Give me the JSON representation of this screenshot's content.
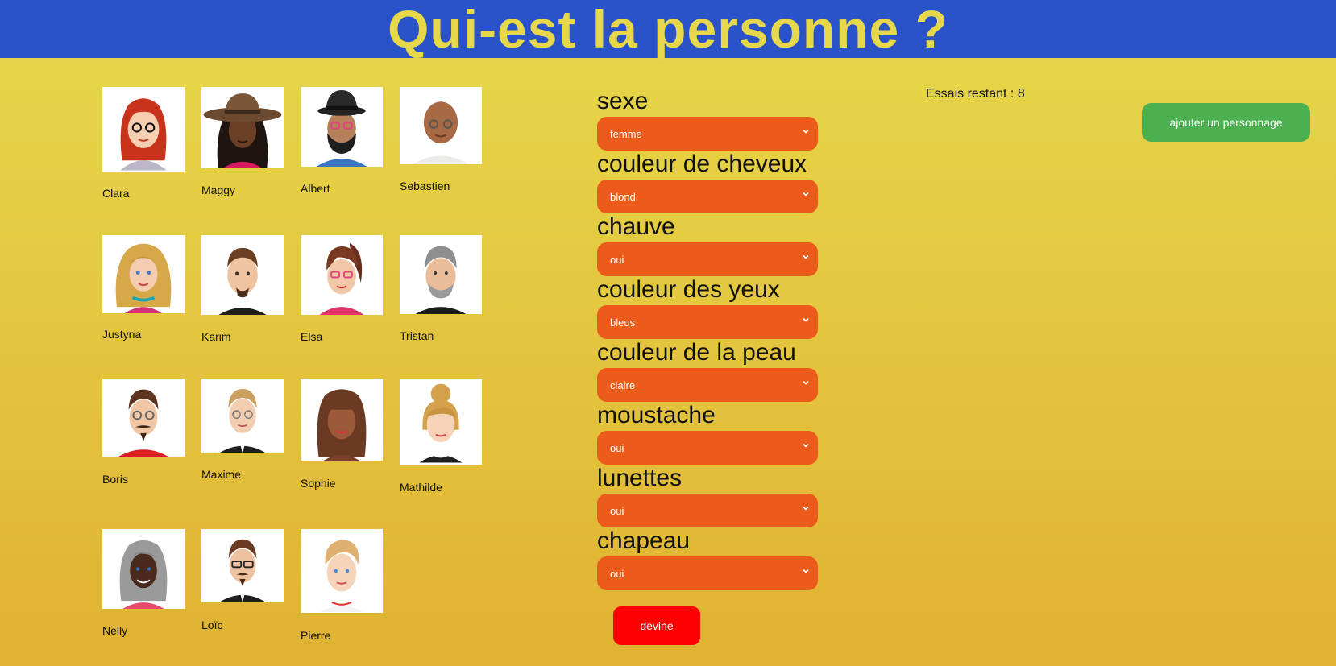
{
  "header": {
    "title": "Qui-est la personne ?"
  },
  "characters": [
    {
      "name": "Clara",
      "icon": "red-hair-woman-glasses-avatar-icon"
    },
    {
      "name": "Maggy",
      "icon": "hat-woman-dark-hair-avatar-icon"
    },
    {
      "name": "Albert",
      "icon": "hat-bearded-man-glasses-avatar-icon"
    },
    {
      "name": "Sebastien",
      "icon": "bald-man-glasses-avatar-icon"
    },
    {
      "name": "Justyna",
      "icon": "blonde-curly-woman-avatar-icon"
    },
    {
      "name": "Karim",
      "icon": "brown-hair-man-beard-avatar-icon"
    },
    {
      "name": "Elsa",
      "icon": "ponytail-woman-glasses-avatar-icon"
    },
    {
      "name": "Tristan",
      "icon": "grey-hair-man-beard-avatar-icon"
    },
    {
      "name": "Boris",
      "icon": "brown-hair-man-glasses-moustache-avatar-icon"
    },
    {
      "name": "Maxime",
      "icon": "blonde-man-glasses-avatar-icon"
    },
    {
      "name": "Sophie",
      "icon": "long-brown-hair-woman-avatar-icon"
    },
    {
      "name": "Mathilde",
      "icon": "blonde-bun-woman-avatar-icon"
    },
    {
      "name": "Nelly",
      "icon": "grey-hair-woman-avatar-icon"
    },
    {
      "name": "Loïc",
      "icon": "man-glasses-goatee-avatar-icon"
    },
    {
      "name": "Pierre",
      "icon": "blonde-young-man-avatar-icon"
    }
  ],
  "form": {
    "fields": [
      {
        "label": "sexe",
        "value": "femme"
      },
      {
        "label": "couleur de cheveux",
        "value": "blond"
      },
      {
        "label": "chauve",
        "value": "oui"
      },
      {
        "label": "couleur des yeux",
        "value": "bleus"
      },
      {
        "label": "couleur de la peau",
        "value": "claire"
      },
      {
        "label": "moustache",
        "value": "oui"
      },
      {
        "label": "lunettes",
        "value": "oui"
      },
      {
        "label": "chapeau",
        "value": "oui"
      }
    ],
    "guess_label": "devine"
  },
  "status": {
    "tries_text": "Essais restant : 8"
  },
  "actions": {
    "add_character_label": "ajouter un personnage"
  },
  "colors": {
    "header_bg": "#2a53c9",
    "title": "#e6d84a",
    "select_bg": "#ea5b1c",
    "guess_bg": "#ff0000",
    "add_bg": "#4caf50"
  }
}
